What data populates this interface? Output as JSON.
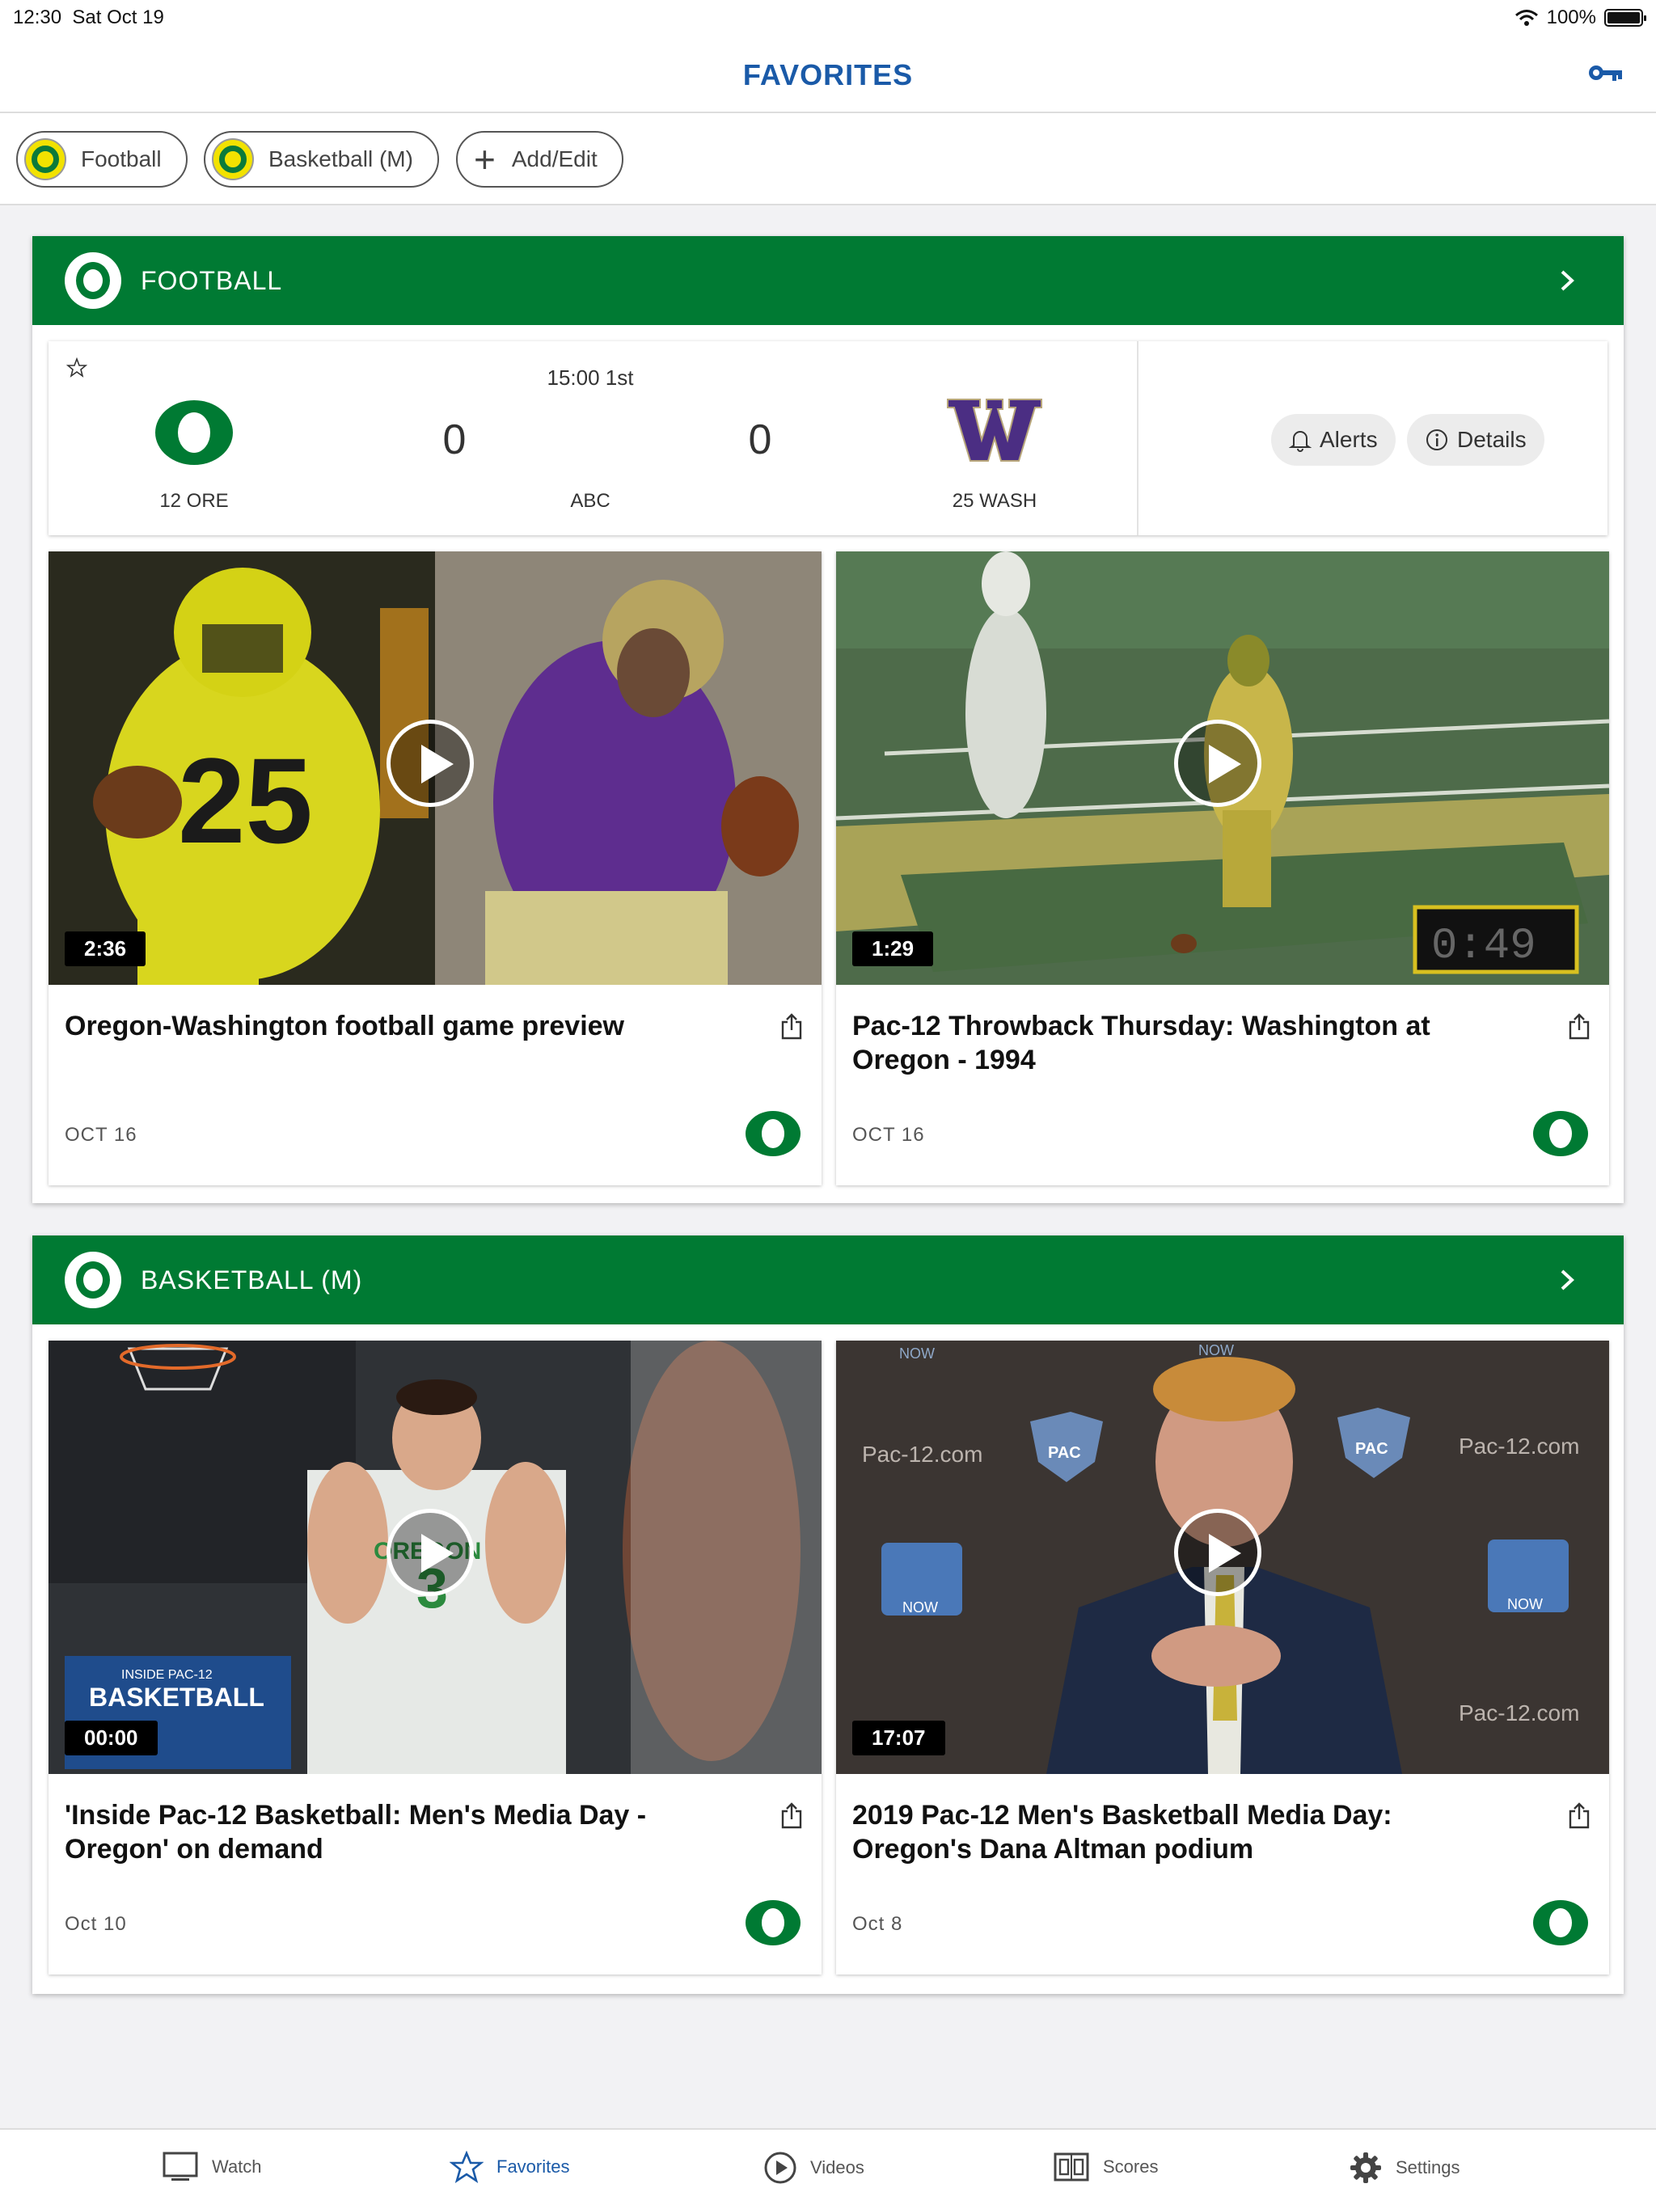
{
  "status_bar": {
    "time": "12:30",
    "date": "Sat Oct 19",
    "battery": "100%"
  },
  "header": {
    "title": "FAVORITES"
  },
  "chips": [
    {
      "label": "Football"
    },
    {
      "label": "Basketball (M)"
    },
    {
      "label": "Add/Edit"
    }
  ],
  "sections": [
    {
      "title": "FOOTBALL",
      "game": {
        "clock": "15:00 1st",
        "network": "ABC",
        "home": {
          "name": "12 ORE",
          "score": "0"
        },
        "away": {
          "name": "25 WASH",
          "score": "0"
        },
        "alerts_label": "Alerts",
        "details_label": "Details"
      },
      "videos": [
        {
          "duration": "2:36",
          "title": "Oregon-Washington football game preview",
          "date": "OCT 16"
        },
        {
          "duration": "1:29",
          "title": "Pac-12 Throwback Thursday: Washington at Oregon - 1994",
          "date": "OCT 16"
        }
      ]
    },
    {
      "title": "BASKETBALL (M)",
      "videos": [
        {
          "duration": "00:00",
          "title": "'Inside Pac-12 Basketball: Men's Media Day - Oregon' on demand",
          "date": "Oct 10"
        },
        {
          "duration": "17:07",
          "title": "2019 Pac-12 Men's Basketball Media Day: Oregon's Dana Altman podium",
          "date": "Oct 8"
        }
      ]
    }
  ],
  "thumb_text": {
    "basketball_banner_small": "INSIDE PAC-12",
    "basketball_banner_big": "BASKETBALL",
    "jersey": "OREGON",
    "backdrop": "Pac-12.com",
    "now": "NOW",
    "pac": "PAC",
    "scoreboard": "0:49"
  },
  "tabbar": [
    {
      "label": "Watch",
      "icon": "tv-icon"
    },
    {
      "label": "Favorites",
      "icon": "star-icon"
    },
    {
      "label": "Videos",
      "icon": "play-circle-icon"
    },
    {
      "label": "Scores",
      "icon": "scoreboard-icon"
    },
    {
      "label": "Settings",
      "icon": "gear-icon"
    }
  ],
  "colors": {
    "oregon_green": "#007a33",
    "oregon_yellow": "#f2e200",
    "washington_purple": "#4b2e83",
    "accent_blue": "#1a5aa8"
  }
}
